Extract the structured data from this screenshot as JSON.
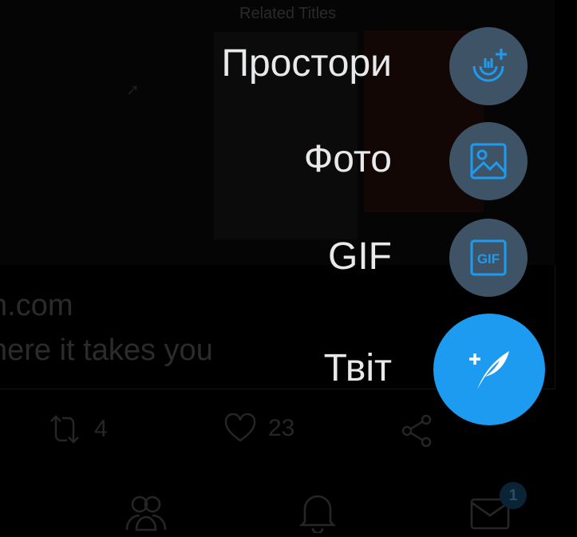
{
  "background": {
    "related_title": "Related Titles",
    "link_domain": "n.com",
    "link_description": "here it takes you",
    "retweet_count": "4",
    "like_count": "23",
    "messages_badge": "1"
  },
  "fab_menu": {
    "items": [
      {
        "label": "Простори",
        "icon": "spaces-add-icon"
      },
      {
        "label": "Фото",
        "icon": "image-icon"
      },
      {
        "label": "GIF",
        "icon": "gif-icon"
      }
    ],
    "main": {
      "label": "Твіт",
      "icon": "compose-feather-icon"
    }
  },
  "colors": {
    "accent": "#1d9bf0",
    "mini_fab_bg": "#3e5466",
    "label_text": "#e7e9ea",
    "backdrop": "#000000"
  }
}
